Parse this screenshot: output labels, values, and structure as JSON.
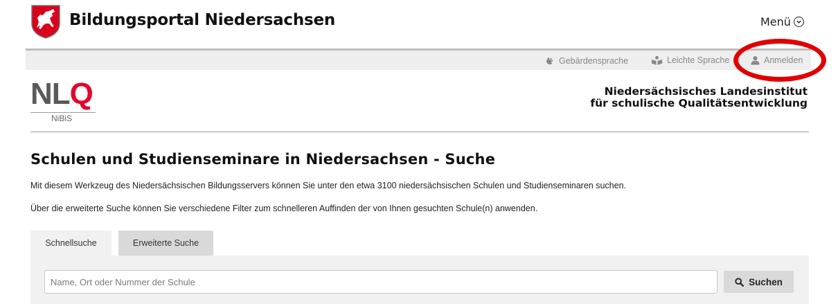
{
  "header": {
    "portal_title": "Bildungsportal Niedersachsen",
    "menu_label": "Menü",
    "crest_icon": "lower-saxony-horse-crest-icon"
  },
  "toolbar": {
    "items": [
      {
        "label": "Gebärdensprache",
        "icon": "sign-language-hand-icon"
      },
      {
        "label": "Leichte Sprache",
        "icon": "easy-language-reader-icon"
      },
      {
        "label": "Anmelden",
        "icon": "user-icon"
      }
    ]
  },
  "annotation": {
    "color": "#e00000"
  },
  "branding": {
    "logo_nl": "NL",
    "logo_q": "Q",
    "logo_sub": "NiBiS",
    "institute_line1": "Niedersächsisches Landesinstitut",
    "institute_line2": "für schulische Qualitätsentwicklung",
    "logo_gray": "#5a5a5a",
    "logo_red": "#e3062d"
  },
  "main": {
    "title": "Schulen und Studienseminare in Niedersachsen - Suche",
    "intro": "Mit diesem Werkzeug des Niedersächsischen Bildungsservers können Sie unter den etwa 3100 niedersächsischen Schulen und Studienseminaren suchen.",
    "filter_note": "Über die erweiterte Suche können Sie verschiedene Filter zum schnelleren Auffinden der von Ihnen gesuchten Schule(n) anwenden.",
    "tabs": [
      {
        "label": "Schnellsuche",
        "active": true
      },
      {
        "label": "Erweiterte Suche",
        "active": false
      }
    ],
    "search": {
      "placeholder": "Name, Ort oder Nummer der Schule",
      "value": "",
      "button_label": "Suchen",
      "button_icon": "search-icon"
    }
  }
}
